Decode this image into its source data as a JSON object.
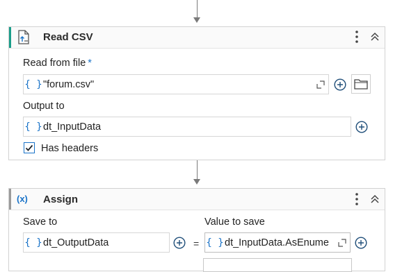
{
  "read_csv": {
    "title": "Read CSV",
    "icon": "read-csv-file-icon",
    "read_from_label": "Read from file",
    "required_mark": "*",
    "read_from_value": "\"forum.csv\"",
    "output_label": "Output to",
    "output_value": "dt_InputData",
    "has_headers_label": "Has headers",
    "has_headers_checked": true
  },
  "assign": {
    "title": "Assign",
    "icon": "variable-x-icon",
    "icon_text": "(x)",
    "save_to_label": "Save to",
    "save_to_value": "dt_OutputData",
    "equals": "=",
    "value_label": "Value to save",
    "value_value": "dt_InputData.AsEnume"
  },
  "common": {
    "braces": "{ }"
  },
  "colors": {
    "accent": "#1a9d8a",
    "blue": "#1a73c8",
    "border": "#d2d2d2",
    "connector": "#7a7a7a"
  }
}
